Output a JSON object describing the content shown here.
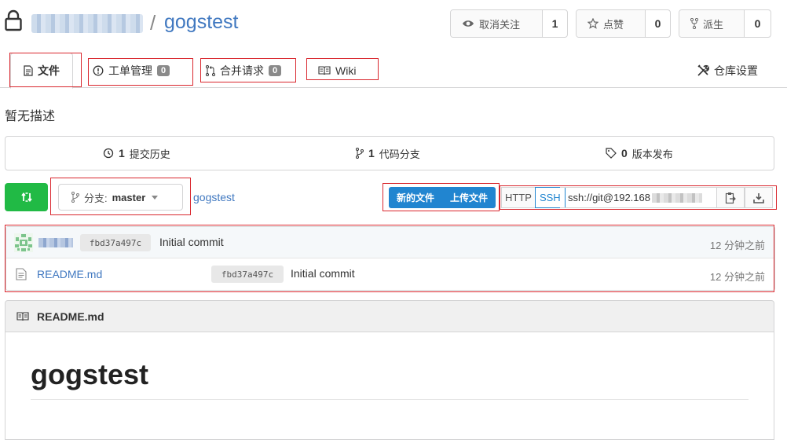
{
  "header": {
    "repo_name": "gogstest",
    "separator": "/",
    "unwatch": {
      "label": "取消关注",
      "count": "1"
    },
    "star": {
      "label": "点赞",
      "count": "0"
    },
    "fork": {
      "label": "派生",
      "count": "0"
    }
  },
  "tabs": [
    {
      "label": "文件",
      "icon": "file-text-icon"
    },
    {
      "label": "工单管理",
      "icon": "issue-icon",
      "badge": "0"
    },
    {
      "label": "合并请求",
      "icon": "pull-request-icon",
      "badge": "0"
    },
    {
      "label": "Wiki",
      "icon": "book-icon"
    }
  ],
  "settings_tab": {
    "label": "仓库设置",
    "icon": "tools-icon"
  },
  "description": "暂无描述",
  "stats": {
    "commits": {
      "count": "1",
      "label": "提交历史"
    },
    "branches": {
      "count": "1",
      "label": "代码分支"
    },
    "releases": {
      "count": "0",
      "label": "版本发布"
    }
  },
  "toolbar": {
    "branch_prefix": "分支:",
    "branch_name": "master",
    "breadcrumb": "gogstest",
    "new_file": "新的文件",
    "upload_file": "上传文件",
    "http": "HTTP",
    "ssh": "SSH",
    "clone_url": "ssh://git@192.168"
  },
  "latest_commit": {
    "sha": "fbd37a497c",
    "message": "Initial commit",
    "time": "12 分钟之前"
  },
  "files": [
    {
      "name": "README.md",
      "sha": "fbd37a497c",
      "message": "Initial commit",
      "time": "12 分钟之前"
    }
  ],
  "readme": {
    "filename": "README.md",
    "heading": "gogstest"
  },
  "colors": {
    "link": "#4078c0",
    "primary": "#2185d0",
    "green": "#21ba45",
    "highlight_box": "#d9272e"
  }
}
